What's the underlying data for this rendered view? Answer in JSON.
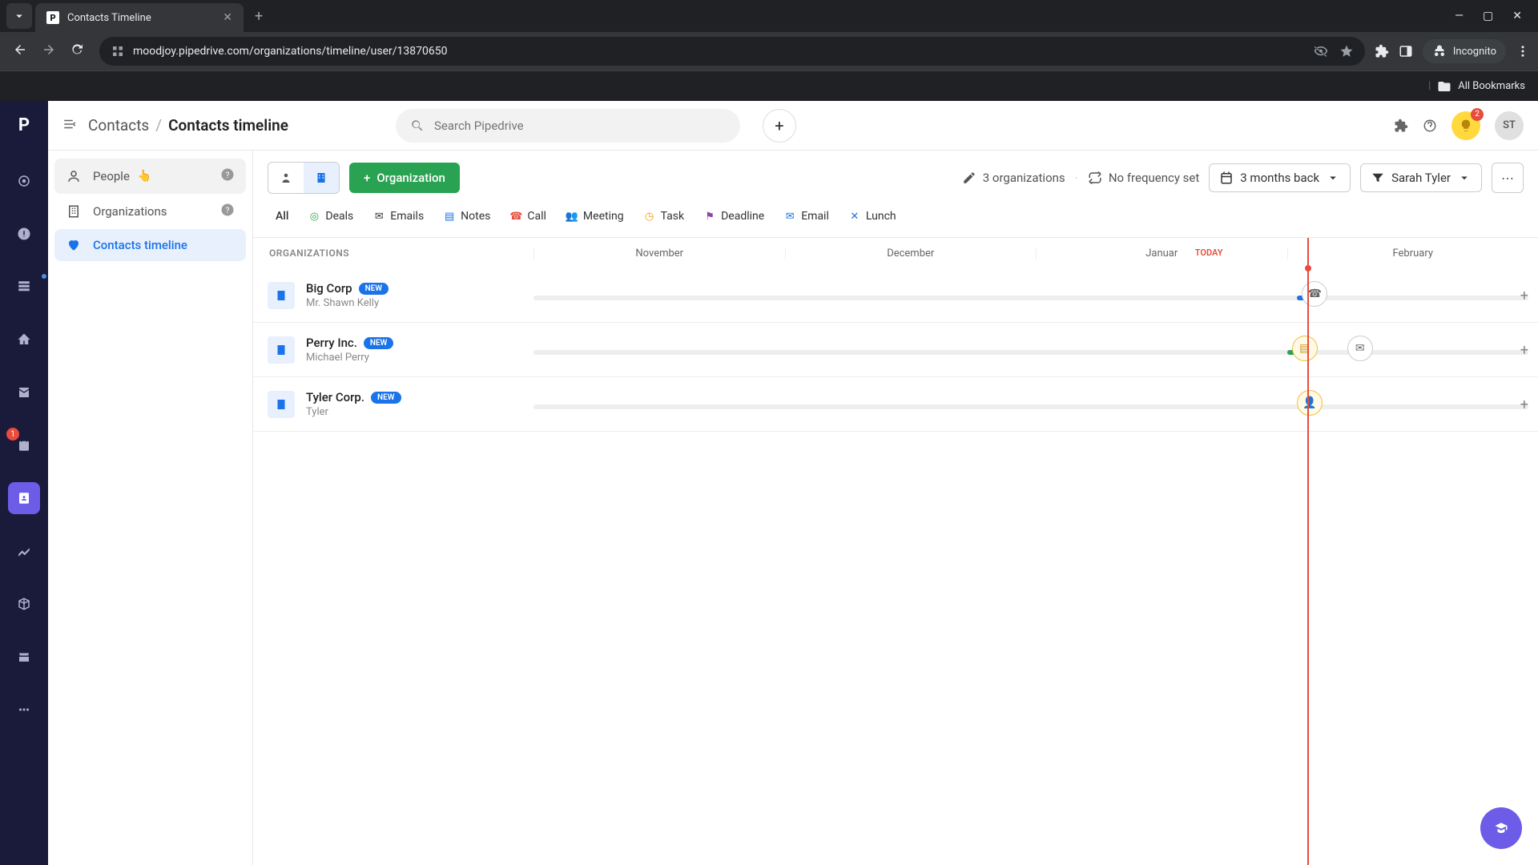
{
  "browser": {
    "tab_title": "Contacts Timeline",
    "url": "moodjoy.pipedrive.com/organizations/timeline/user/13870650",
    "incognito": "Incognito",
    "all_bookmarks": "All Bookmarks"
  },
  "rail": {
    "badge_count": "1"
  },
  "topbar": {
    "breadcrumb_parent": "Contacts",
    "breadcrumb_current": "Contacts timeline",
    "search_placeholder": "Search Pipedrive",
    "avatar_initials": "ST",
    "tip_badge": "2"
  },
  "sidebar": {
    "items": [
      {
        "label": "People"
      },
      {
        "label": "Organizations"
      },
      {
        "label": "Contacts timeline"
      }
    ]
  },
  "toolbar": {
    "org_button": "Organization",
    "count_text": "3 organizations",
    "frequency_text": "No frequency set",
    "range_label": "3 months back",
    "owner_label": "Sarah Tyler"
  },
  "filters": {
    "all": "All",
    "items": [
      {
        "label": "Deals",
        "color": "#29a352"
      },
      {
        "label": "Emails",
        "color": "#333"
      },
      {
        "label": "Notes",
        "color": "#1a73e8"
      },
      {
        "label": "Call",
        "color": "#e74c3c"
      },
      {
        "label": "Meeting",
        "color": "#1a73e8"
      },
      {
        "label": "Task",
        "color": "#f39c12"
      },
      {
        "label": "Deadline",
        "color": "#8e44ad"
      },
      {
        "label": "Email",
        "color": "#1a73e8"
      },
      {
        "label": "Lunch",
        "color": "#1a73e8"
      }
    ]
  },
  "timeline": {
    "header": "ORGANIZATIONS",
    "today_label": "TODAY",
    "months": [
      "November",
      "December",
      "Januar",
      "February"
    ],
    "rows": [
      {
        "name": "Big Corp",
        "contact": "Mr. Shawn Kelly",
        "badge": "NEW"
      },
      {
        "name": "Perry Inc.",
        "contact": "Michael Perry",
        "badge": "NEW"
      },
      {
        "name": "Tyler Corp.",
        "contact": "Tyler",
        "badge": "NEW"
      }
    ]
  }
}
